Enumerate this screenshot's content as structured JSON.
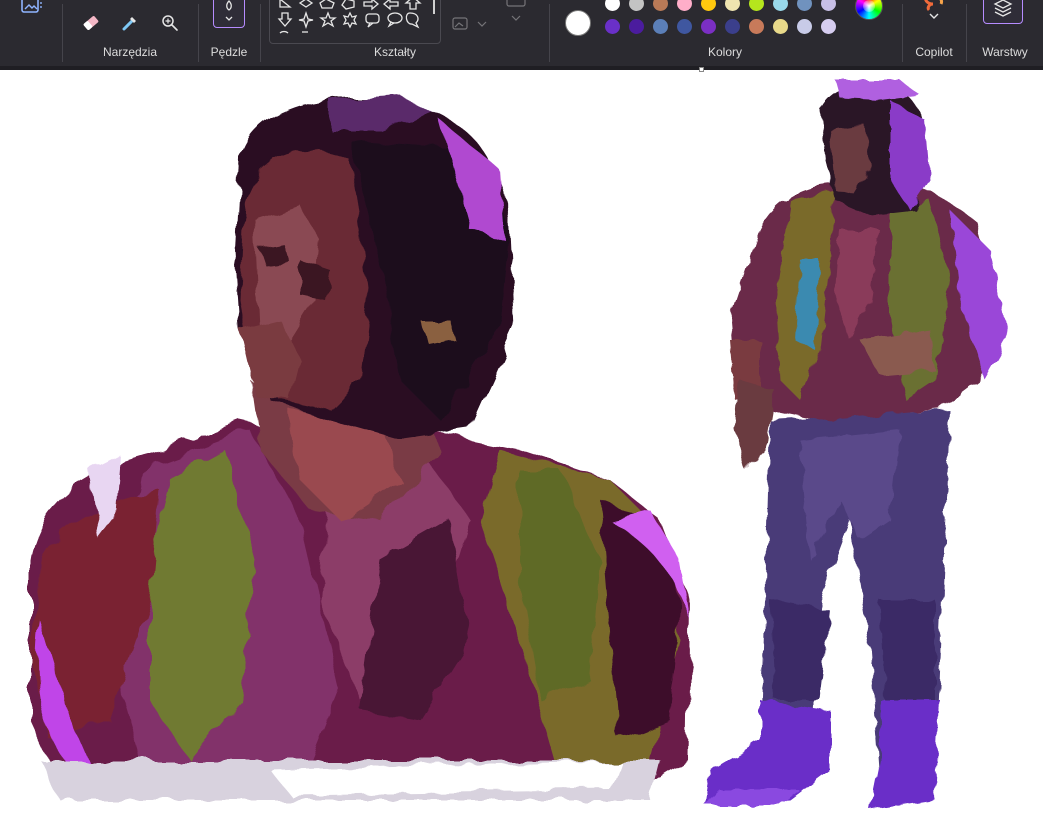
{
  "ribbon": {
    "groups": {
      "tools": "Narzędzia",
      "brushes": "Pędzle",
      "shapes": "Kształty",
      "colors": "Kolory",
      "copilot": "Copilot",
      "layers": "Warstwy"
    }
  },
  "colors": {
    "current": "#ffffff",
    "row1": [
      "#ffffff",
      "#c3c3c3",
      "#b97a57",
      "#ffaec9",
      "#ffc90e",
      "#efe4b0",
      "#b5e61d",
      "#99d9ea",
      "#7092be",
      "#c8bfe7"
    ],
    "row2": [
      "#6a30c8",
      "#4b1c9e",
      "#5b7fb8",
      "#3f57a0",
      "#7b2fc4",
      "#3b3f8c",
      "#c87a5a",
      "#e8d98a",
      "#c8cbe8",
      "#d6cdf0"
    ]
  },
  "icons": {
    "image": "image-icon",
    "eraser": "eraser-icon",
    "picker": "color-picker-icon",
    "zoom": "magnifier-icon",
    "brush": "brush-icon",
    "copilot": "copilot-icon",
    "layers": "layers-icon"
  }
}
